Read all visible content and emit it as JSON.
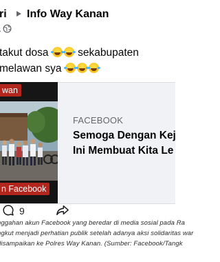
{
  "header": {
    "author_partial": "ri",
    "group": "Info Way Kanan",
    "meta_dot": "·"
  },
  "post": {
    "line1_a": "takut dosa",
    "line1_b": "sekabupaten",
    "line2": "melawan sya",
    "emoji": "rolling-on-floor-laughing"
  },
  "card": {
    "thumb_top_label": "wan",
    "thumb_bottom_label": "n Facebook",
    "site": "FACEBOOK",
    "title_line1": "Semoga Dengan Kej",
    "title_line2": "Ini Membuat Kita Le"
  },
  "actions": {
    "comment_count": "9"
  },
  "caption": {
    "line1": "nggahan akun Facebook yang beredar di media sosial pada Ra",
    "line2": "ngkut menjadi perhatian publik setelah adanya aksi solidaritas war",
    "line3": "disampaikan ke Polres Way Kanan. (Sumber: Facebook/Tangk"
  },
  "colors": {
    "accent_red": "#b3261e",
    "secondary_text": "#65676b",
    "card_bg": "#f0f2f5"
  }
}
